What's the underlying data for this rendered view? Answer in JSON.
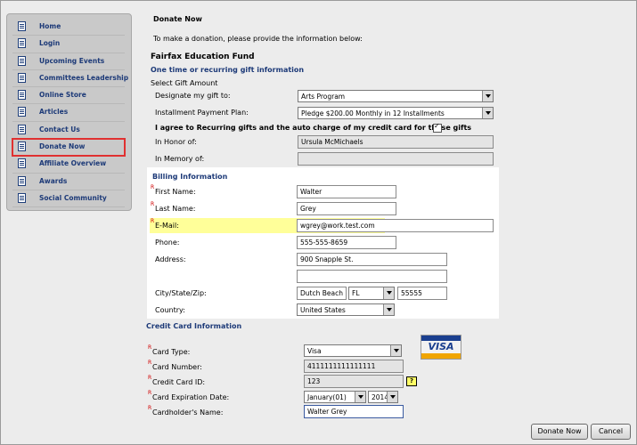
{
  "sidebar": {
    "items": [
      {
        "label": "Home",
        "active": false
      },
      {
        "label": "Login",
        "active": false
      },
      {
        "label": "Upcoming Events",
        "active": false
      },
      {
        "label": "Committees Leadership",
        "active": false
      },
      {
        "label": "Online Store",
        "active": false
      },
      {
        "label": "Articles",
        "active": false
      },
      {
        "label": "Contact Us",
        "active": false
      },
      {
        "label": "Donate Now",
        "active": true
      },
      {
        "label": "Affiliate Overview",
        "active": false
      },
      {
        "label": "Awards",
        "active": false
      },
      {
        "label": "Social Community",
        "active": false
      }
    ]
  },
  "header": {
    "title": "Donate Now",
    "instructions": "To make a donation, please provide the information below:"
  },
  "fund": {
    "name": "Fairfax Education Fund",
    "section_title": "One time or recurring gift information",
    "select_gift_amount": "Select Gift Amount",
    "designate_label": "Designate my gift to:",
    "designate_value": "Arts Program",
    "installment_label": "Installment Payment Plan:",
    "installment_value": "Pledge $200.00 Monthly in 12 Installments",
    "agree_label": "I agree to Recurring gifts and the auto charge of my credit card for these gifts",
    "agree_checked": true,
    "in_honor_label": "In Honor of:",
    "in_honor_value": "Ursula McMichaels",
    "in_memory_label": "In Memory of:",
    "in_memory_value": ""
  },
  "billing": {
    "title": "Billing Information",
    "required_marker": "R",
    "first_name_label": "First Name:",
    "first_name": "Walter",
    "last_name_label": "Last Name:",
    "last_name": "Grey",
    "email_label": "E-Mail:",
    "email": "wgrey@work.test.com",
    "phone_label": "Phone:",
    "phone": "555-555-8659",
    "address_label": "Address:",
    "address1": "900 Snapple St.",
    "address2": "",
    "city_label": "City/State/Zip:",
    "city": "Dutch Beach",
    "state": "FL",
    "zip": "55555",
    "country_label": "Country:",
    "country": "United States"
  },
  "credit_card": {
    "title": "Credit Card Information",
    "card_type_label": "Card Type:",
    "card_type": "Visa",
    "card_logo_text": "VISA",
    "card_number_label": "Card Number:",
    "card_number": "4111111111111111",
    "card_id_label": "Credit Card ID:",
    "card_id": "123",
    "help_glyph": "?",
    "expiration_label": "Card Expiration Date:",
    "exp_month": "January(01)",
    "exp_year": "2014",
    "holder_label": "Cardholder's Name:",
    "holder_name": "Walter Grey"
  },
  "actions": {
    "donate_label": "Donate Now",
    "cancel_label": "Cancel"
  },
  "colors": {
    "accent": "#1d3a78",
    "required": "#d00000",
    "highlight": "#ffff99",
    "active_outline": "#e03030"
  }
}
